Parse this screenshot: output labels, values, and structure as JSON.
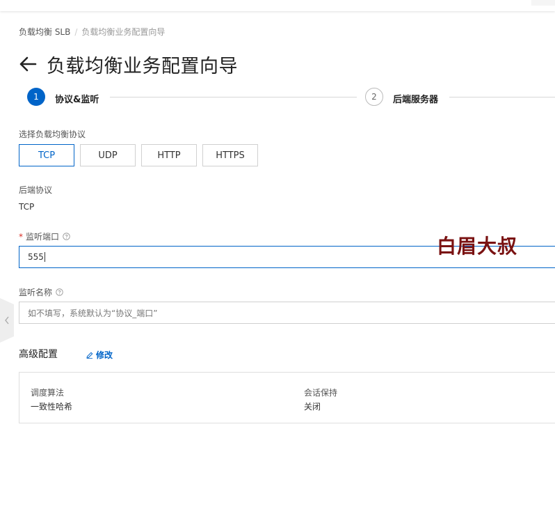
{
  "breadcrumb": {
    "root": "负载均衡 SLB",
    "separator": "/",
    "current": "负载均衡业务配置向导"
  },
  "page": {
    "title": "负载均衡业务配置向导"
  },
  "steps": [
    {
      "number": "1",
      "label": "协议&监听",
      "state": "active"
    },
    {
      "number": "2",
      "label": "后端服务器",
      "state": "inactive"
    }
  ],
  "protocol": {
    "label": "选择负载均衡协议",
    "options": [
      "TCP",
      "UDP",
      "HTTP",
      "HTTPS"
    ],
    "selected": "TCP"
  },
  "backend_protocol": {
    "label": "后端协议",
    "value": "TCP"
  },
  "listen_port": {
    "required_mark": "*",
    "label": "监听端口",
    "value": "555"
  },
  "listen_name": {
    "label": "监听名称",
    "placeholder": "如不填写，系统默认为“协议_端口”",
    "value": ""
  },
  "advanced": {
    "title": "高级配置",
    "edit_label": "修改",
    "items": [
      {
        "key": "调度算法",
        "value": "一致性哈希"
      },
      {
        "key": "会话保持",
        "value": "关闭"
      }
    ]
  },
  "watermark": {
    "text": "白眉大叔"
  },
  "colors": {
    "primary": "#0064c8",
    "required": "#d93026",
    "watermark": "#7a1212"
  }
}
